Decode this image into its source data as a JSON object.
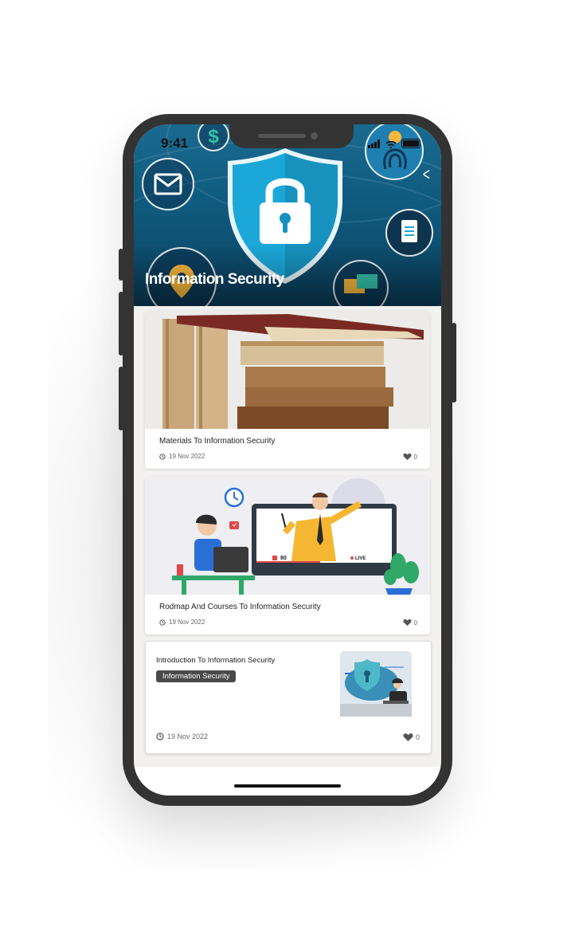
{
  "status_bar": {
    "time": "9:41"
  },
  "hero": {
    "title": "Information Security"
  },
  "articles": [
    {
      "title": "Materials To Information  Security",
      "date": "19 Nov 2022",
      "likes": "0"
    },
    {
      "title": "Rodmap And Courses To Information Security",
      "date": "19 Nov 2022",
      "likes": "0"
    },
    {
      "title": "Introduction To Information Security",
      "tag": "Information Security",
      "date": "19 Nov 2022",
      "likes": "0"
    }
  ],
  "illustration_text": {
    "viewers": "80",
    "live": "LIVE"
  },
  "colors": {
    "accent": "#1ba8d8",
    "hero_bg": "#0f5a7e",
    "card_bg": "#ffffff",
    "tag_bg": "#4a4a4a"
  },
  "icons": [
    "clock-icon",
    "heart-icon",
    "back-chevron-icon",
    "lock-icon",
    "mail-icon",
    "document-icon",
    "location-icon",
    "fingerprint-icon",
    "dollar-icon"
  ]
}
